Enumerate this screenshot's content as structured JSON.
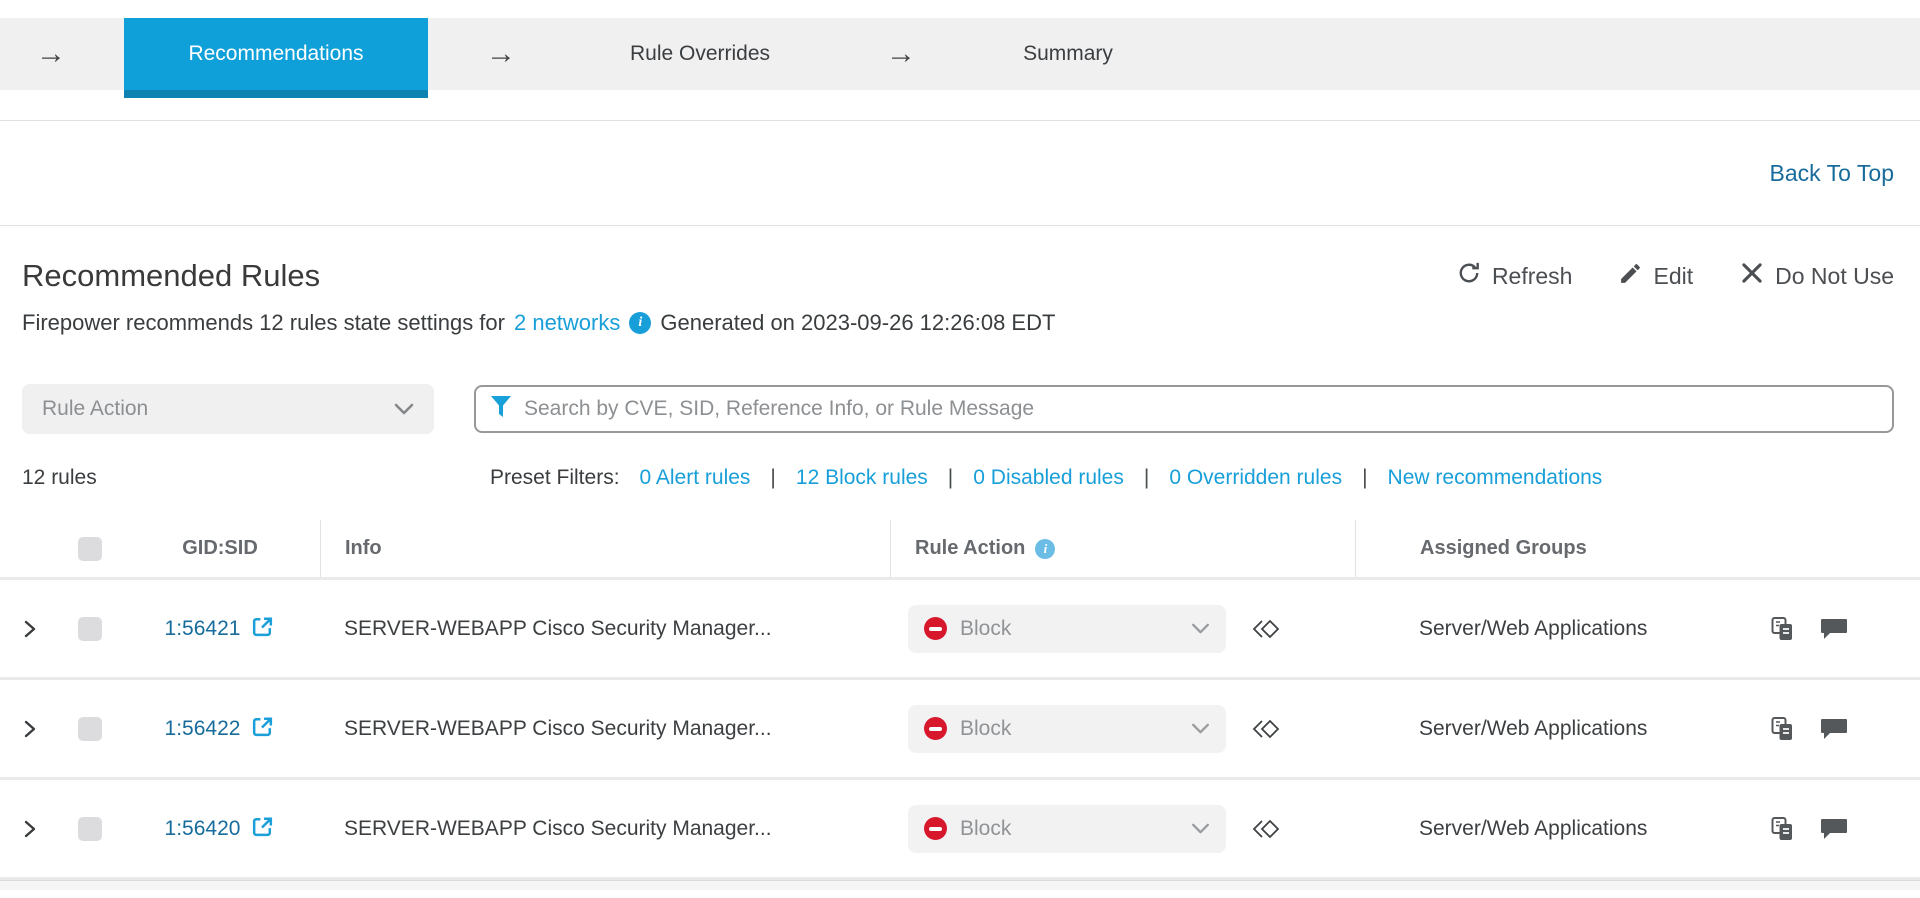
{
  "stepper": {
    "arrow": "→",
    "steps": [
      {
        "label": "Recommendations",
        "active": true
      },
      {
        "label": "Rule Overrides",
        "active": false
      },
      {
        "label": "Summary",
        "active": false
      }
    ]
  },
  "back_to_top": "Back To Top",
  "header": {
    "title": "Recommended Rules",
    "subtitle_prefix": "Firepower recommends 12 rules state settings for",
    "networks_link": "2 networks",
    "subtitle_suffix": "Generated on 2023-09-26 12:26:08 EDT",
    "actions": {
      "refresh": "Refresh",
      "edit": "Edit",
      "do_not_use": "Do Not Use"
    }
  },
  "filters": {
    "rule_action_placeholder": "Rule Action",
    "search_placeholder": "Search by CVE, SID, Reference Info, or Rule Message",
    "rules_count": "12 rules",
    "preset_label": "Preset Filters:",
    "separator": "|",
    "preset_links": [
      "0 Alert rules",
      "12 Block rules",
      "0 Disabled rules",
      "0 Overridden rules",
      "New recommendations"
    ]
  },
  "table": {
    "columns": [
      "GID:SID",
      "Info",
      "Rule Action",
      "Assigned Groups"
    ],
    "rows": [
      {
        "gid_sid": "1:56421",
        "info": "SERVER-WEBAPP Cisco Security Manager...",
        "rule_action": "Block",
        "assigned_groups": "Server/Web Applications"
      },
      {
        "gid_sid": "1:56422",
        "info": "SERVER-WEBAPP Cisco Security Manager...",
        "rule_action": "Block",
        "assigned_groups": "Server/Web Applications"
      },
      {
        "gid_sid": "1:56420",
        "info": "SERVER-WEBAPP Cisco Security Manager...",
        "rule_action": "Block",
        "assigned_groups": "Server/Web Applications"
      }
    ]
  },
  "icons": {
    "stepper_arrow": "right-arrow",
    "refresh": "refresh-icon",
    "edit": "pencil-icon",
    "do_not_use": "x-icon",
    "search_filter": "funnel-icon",
    "info": "info-circle-icon",
    "external_link": "external-link-icon",
    "rule_action_state": "minus-circle-icon",
    "revert": "revert-default-icon",
    "documentation": "rule-documentation-icon",
    "comment": "comment-icon"
  },
  "colors": {
    "accent_blue": "#0FA0D9",
    "accent_blue_dark": "#0E83B2",
    "link_blue": "#189FD9",
    "link_teal": "#176C9C",
    "block_red": "#D7172C",
    "bar_gray": "#F0F0F1"
  }
}
